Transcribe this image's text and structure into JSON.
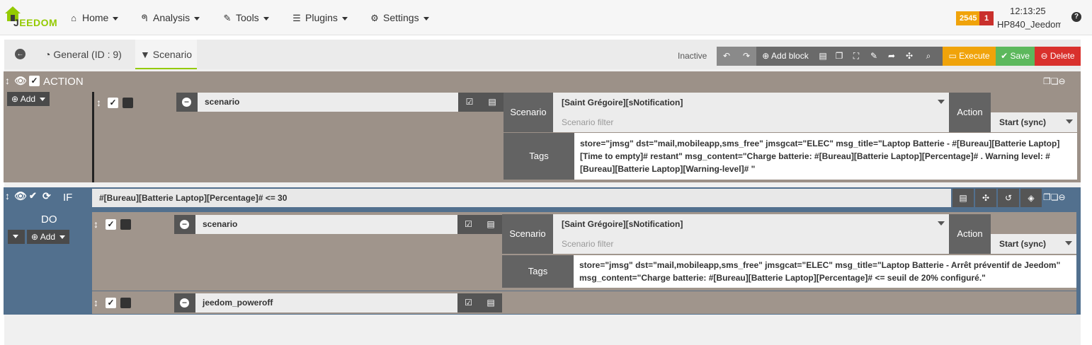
{
  "navbar": {
    "logo_text_1": "J",
    "logo_text_2": "EEDOM",
    "items": [
      {
        "label": "Home",
        "icon": "home-icon"
      },
      {
        "label": "Analysis",
        "icon": "stethoscope-icon"
      },
      {
        "label": "Tools",
        "icon": "wrench-icon"
      },
      {
        "label": "Plugins",
        "icon": "tasks-icon"
      },
      {
        "label": "Settings",
        "icon": "gear-icon"
      }
    ],
    "badge_count": "2545",
    "badge_alert": "1",
    "time": "12:13:25",
    "host": "HP840_Jeedom",
    "help_glyph": "?"
  },
  "tabs": {
    "general": "General (ID : 9)",
    "scenario": "Scenario"
  },
  "toolbar": {
    "status": "Inactive",
    "add_block": "Add block",
    "execute": "Execute",
    "save": "Save",
    "delete": "Delete"
  },
  "action_block": {
    "title": "ACTION",
    "add": "Add",
    "cmd_name": "scenario",
    "scenario_label": "Scenario",
    "scenario_value": "[Saint Grégoire][sNotification]",
    "filter_placeholder": "Scenario filter",
    "action_label": "Action",
    "action_value": "Start (sync)",
    "tags_label": "Tags",
    "tags_value": "store=\"jmsg\" dst=\"mail,mobileapp,sms_free\" jmsgcat=\"ELEC\" msg_title=\"Laptop Batterie - #[Bureau][Batterie Laptop][Time to empty]# restant\" msg_content=\"Charge batterie: #[Bureau][Batterie Laptop][Percentage]# . Warning level: #[Bureau][Batterie Laptop][Warning-level]#  \""
  },
  "if_block": {
    "title": "IF",
    "condition": "#[Bureau][Batterie Laptop][Percentage]# <= 30",
    "do_label": "DO",
    "add": "Add",
    "cmd1_name": "scenario",
    "scenario_label": "Scenario",
    "scenario_value": "[Saint Grégoire][sNotification]",
    "filter_placeholder": "Scenario filter",
    "action_label": "Action",
    "action_value": "Start (sync)",
    "tags_label": "Tags",
    "tags_value": "store=\"jmsg\" dst=\"mail,mobileapp,sms_free\" jmsgcat=\"ELEC\" msg_title=\"Laptop Batterie - Arrêt préventif de Jeedom\" msg_content=\"Charge batterie: #[Bureau][Batterie Laptop][Percentage]# <= seuil de 20% configuré.\"",
    "cmd2_name": "jeedom_poweroff"
  }
}
